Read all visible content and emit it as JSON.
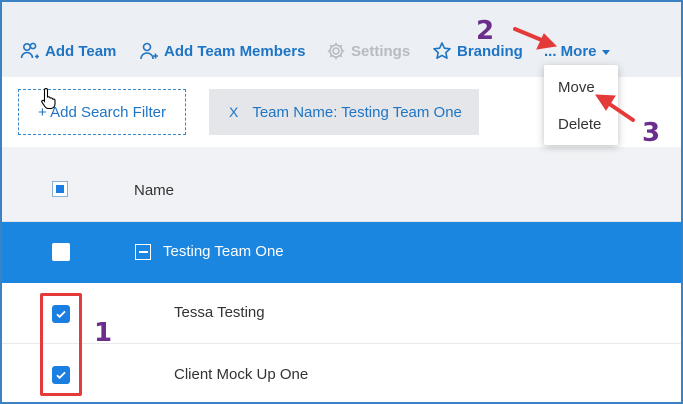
{
  "toolbar": {
    "add_team": "Add Team",
    "add_team_members": "Add Team Members",
    "settings": "Settings",
    "branding": "Branding",
    "more": "... More"
  },
  "filters": {
    "add_filter": "+ Add Search Filter",
    "chip_x": "X",
    "chip_label": "Team Name:  Testing Team One"
  },
  "table": {
    "header_name": "Name",
    "team_row": "Testing Team One",
    "rows": [
      "Tessa Testing",
      "Client Mock Up One"
    ]
  },
  "dropdown": {
    "items": [
      "Move",
      "Delete"
    ]
  },
  "annotations": {
    "step1": "1",
    "step2": "2",
    "step3": "3"
  },
  "colors": {
    "accent": "#1f75c4",
    "selected_row": "#1b86e0",
    "annotation_red": "#e53a3a",
    "annotation_purple": "#6b2e8c"
  }
}
